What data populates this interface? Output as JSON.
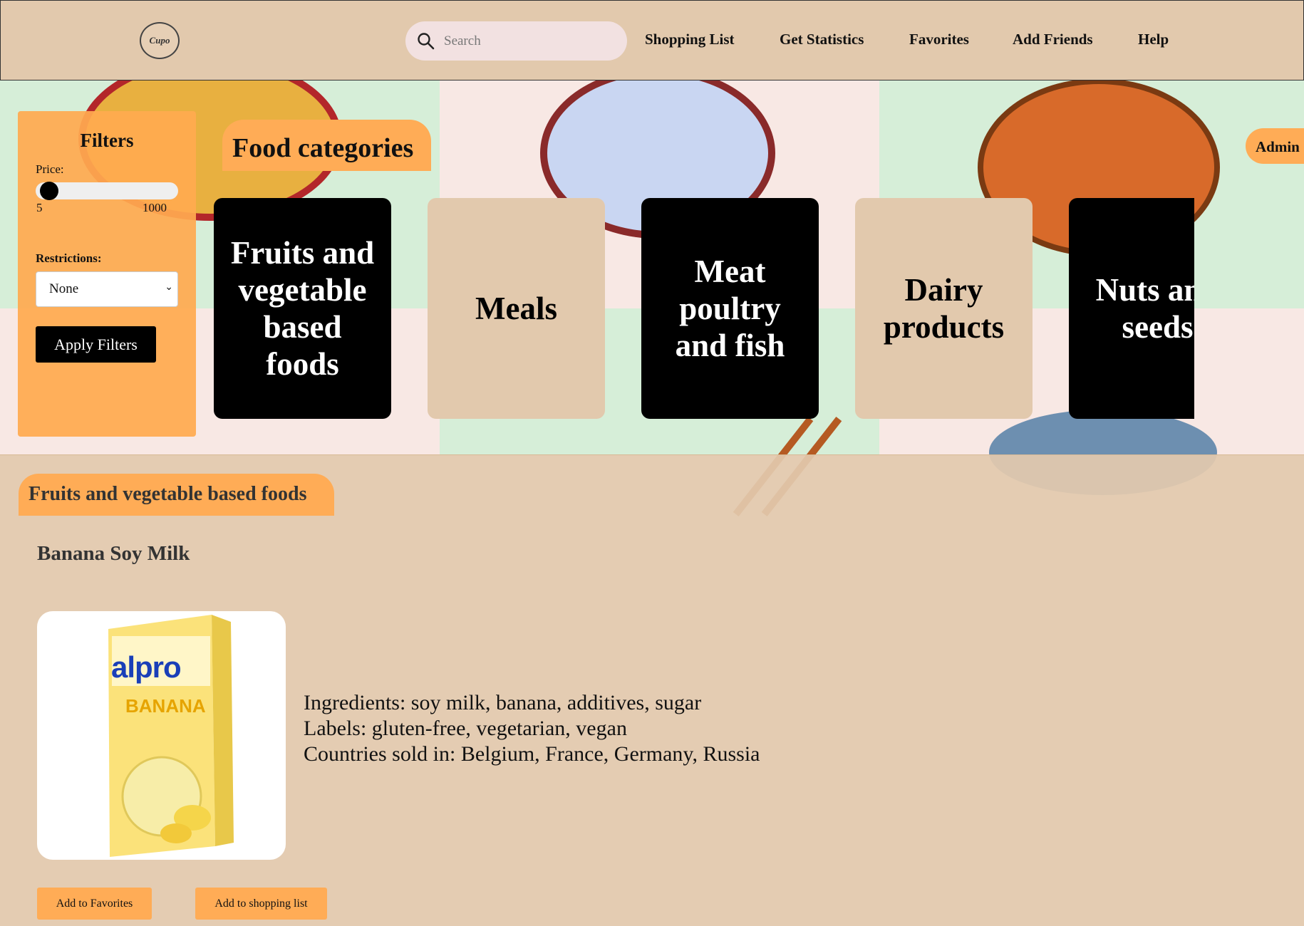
{
  "header": {
    "logo_text": "Cupo",
    "search_placeholder": "Search",
    "nav": [
      "Shopping List",
      "Get Statistics",
      "Favorites",
      "Add Friends",
      "Help"
    ]
  },
  "filters": {
    "title": "Filters",
    "price_label": "Price:",
    "price_min": "5",
    "price_max": "1000",
    "restrictions_label": "Restrictions:",
    "restriction_selected": "None",
    "apply_label": "Apply Filters"
  },
  "categories": {
    "title": "Food categories",
    "items": [
      "Fruits and vegetable based foods",
      "Meals",
      "Meat poultry and fish",
      "Dairy products",
      "Nuts and seeds"
    ]
  },
  "admin_label": "Admin",
  "product_section": {
    "title": "Fruits and vegetable based foods",
    "product_name": "Banana Soy Milk",
    "image_brand": "alpro",
    "image_flavor": "BANANA",
    "ingredients": "Ingredients: soy milk, banana, additives, sugar",
    "labels": "Labels: gluten-free, vegetarian, vegan",
    "countries": "Countries sold in: Belgium, France, Germany, Russia",
    "add_favorites": "Add to Favorites",
    "add_shopping": "Add to shopping list"
  },
  "colors": {
    "header_bg": "#e2c9ad",
    "accent_orange": "#ffac56",
    "card_dark": "#000000",
    "card_light": "#e2c9ad",
    "tile_green": "#d6eed8",
    "tile_pink": "#f8e8e4"
  }
}
